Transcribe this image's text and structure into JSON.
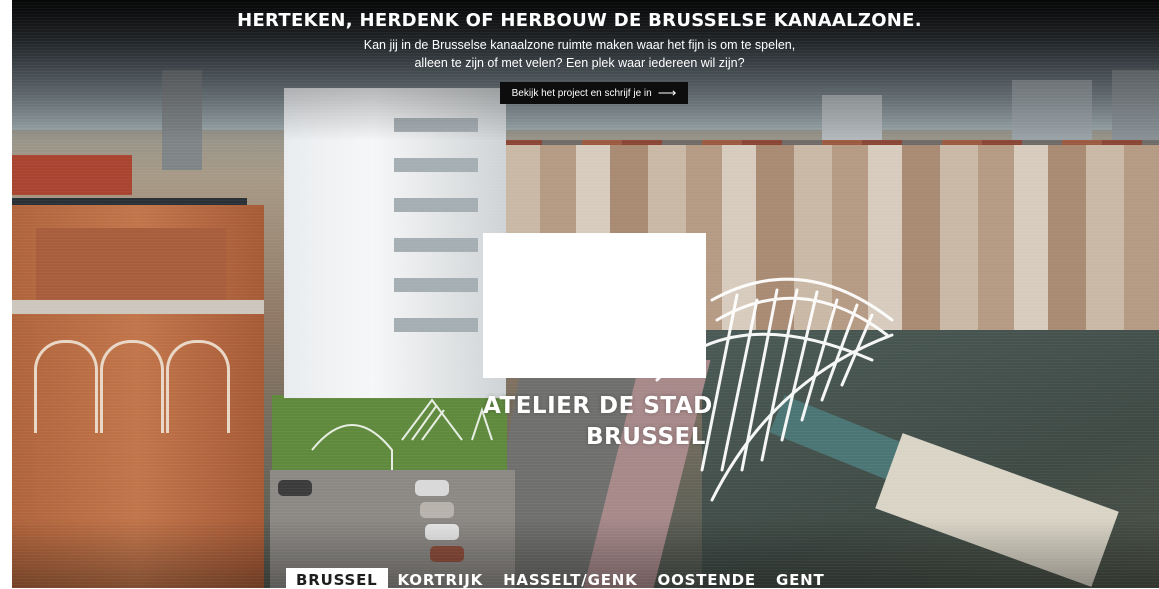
{
  "hero": {
    "headline": "HERTEKEN, HERDENK OF HERBOUW DE BRUSSELSE KANAALZONE.",
    "subline_1": "Kan jij in de Brusselse kanaalzone ruimte maken waar het fijn is om te spelen,",
    "subline_2": "alleen te zijn of met velen? Een plek waar iedereen wil zijn?",
    "cta_label": "Bekijk het project en schrijf je in",
    "cta_icon": "arrow-right-icon"
  },
  "logo": {
    "line_1": "ATELIER DE STAD",
    "line_2": "BRUSSEL"
  },
  "nav": {
    "items": [
      {
        "label": "BRUSSEL",
        "active": true
      },
      {
        "label": "KORTRIJK",
        "active": false
      },
      {
        "label": "HASSELT/GENK",
        "active": false
      },
      {
        "label": "OOSTENDE",
        "active": false
      },
      {
        "label": "GENT",
        "active": false
      }
    ]
  },
  "colors": {
    "cta_background": "#0d0d0d",
    "nav_active_background": "#ffffff",
    "text": "#ffffff"
  }
}
